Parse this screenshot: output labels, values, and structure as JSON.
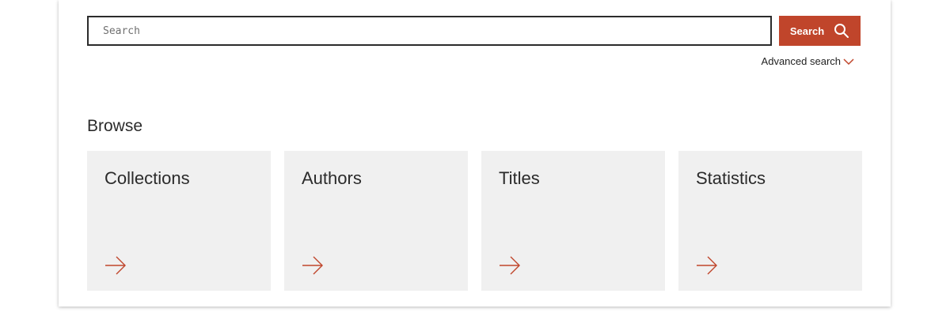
{
  "search": {
    "placeholder": "Search",
    "button_label": "Search"
  },
  "advanced_search": {
    "label": "Advanced search"
  },
  "browse": {
    "title": "Browse",
    "cards": [
      {
        "label": "Collections",
        "icon": "arrow-right-icon"
      },
      {
        "label": "Authors",
        "icon": "arrow-right-icon"
      },
      {
        "label": "Titles",
        "icon": "arrow-right-icon"
      },
      {
        "label": "Statistics",
        "icon": "arrow-right-icon"
      }
    ]
  },
  "colors": {
    "accent": "#c0452b",
    "card_background": "#f0f0f0",
    "text": "#2b2b2b"
  }
}
